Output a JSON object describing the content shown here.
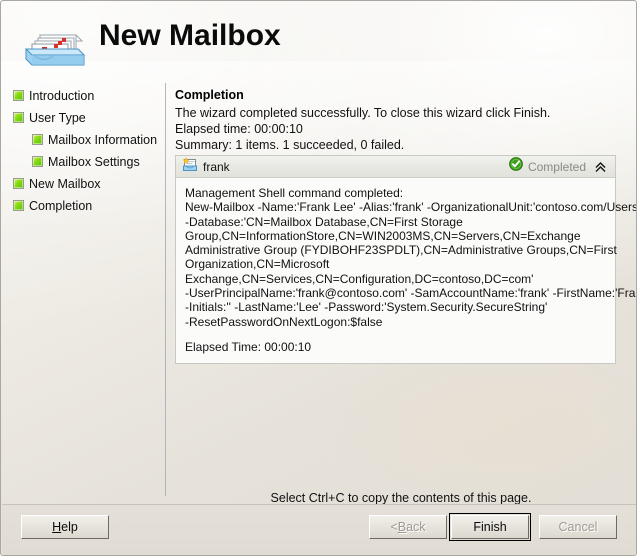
{
  "window": {
    "title": "New Mailbox",
    "icon": "mailbox-tray-icon"
  },
  "sidebar": {
    "items": [
      {
        "label": "Introduction",
        "icon": "green-square-icon",
        "indent": false
      },
      {
        "label": "User Type",
        "icon": "green-square-icon",
        "indent": false
      },
      {
        "label": "Mailbox Information",
        "icon": "green-square-icon",
        "indent": true
      },
      {
        "label": "Mailbox Settings",
        "icon": "green-square-icon",
        "indent": true
      },
      {
        "label": "New Mailbox",
        "icon": "green-square-icon",
        "indent": false
      },
      {
        "label": "Completion",
        "icon": "green-square-icon",
        "indent": false
      }
    ]
  },
  "main": {
    "heading": "Completion",
    "description": "The wizard completed successfully. To close this wizard click Finish.",
    "elapsed_time_line": "Elapsed time: 00:00:10",
    "summary_line": "Summary: 1 items. 1 succeeded, 0 failed."
  },
  "result": {
    "item_name": "frank",
    "item_icon": "new-mailbox-item-icon",
    "status_label": "Completed",
    "status_icon": "green-check-circle-icon",
    "status_color": "#3aa01a",
    "collapse_icon": "double-chevron-up-icon",
    "command_lines": [
      "Management Shell command completed:",
      "New-Mailbox -Name:'Frank Lee' -Alias:'frank' -OrganizationalUnit:'contoso.com/Users'",
      "-Database:'CN=Mailbox Database,CN=First Storage",
      "Group,CN=InformationStore,CN=WIN2003MS,CN=Servers,CN=Exchange",
      "Administrative Group (FYDIBOHF23SPDLT),CN=Administrative Groups,CN=First",
      "Organization,CN=Microsoft",
      "Exchange,CN=Services,CN=Configuration,DC=contoso,DC=com'",
      "-UserPrincipalName:'frank@contoso.com' -SamAccountName:'frank' -FirstName:'Frank'",
      "-Initials:'' -LastName:'Lee' -Password:'System.Security.SecureString'",
      "-ResetPasswordOnNextLogon:$false"
    ],
    "elapsed_time_label": "Elapsed Time: 00:00:10"
  },
  "footer": {
    "hint": "Select Ctrl+C to copy the contents of this page."
  },
  "buttons": {
    "help": {
      "label": "Help",
      "accel": "H",
      "disabled": false
    },
    "back": {
      "label": "Back",
      "accel": "B",
      "prefix": "< ",
      "disabled": true
    },
    "finish": {
      "label": "Finish",
      "disabled": false,
      "is_default": true
    },
    "cancel": {
      "label": "Cancel",
      "disabled": true
    }
  }
}
